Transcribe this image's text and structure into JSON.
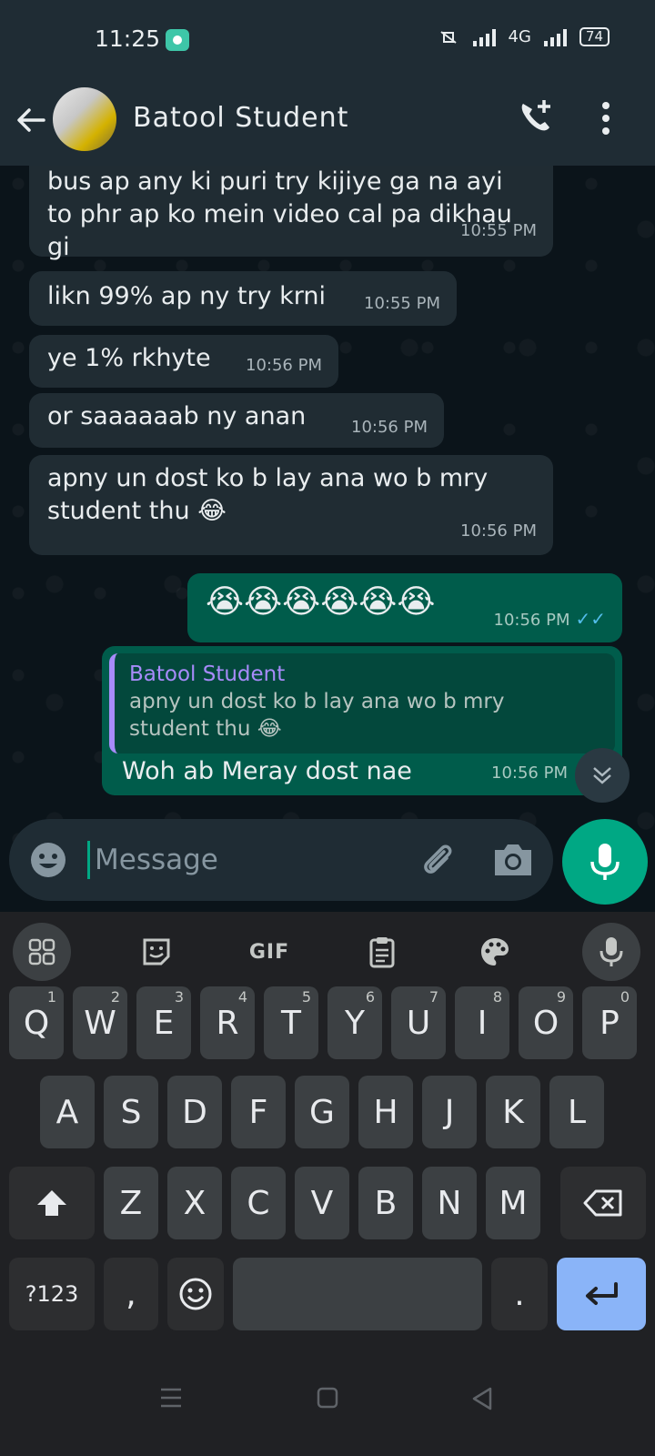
{
  "status_bar": {
    "time": "11:25",
    "network": "4G",
    "battery": "74"
  },
  "header": {
    "contact_name": "Batool Student",
    "icons": [
      "back-arrow-icon",
      "avatar",
      "add-call-icon",
      "more-vert-icon"
    ]
  },
  "messages": [
    {
      "direction": "in",
      "text_lines": [
        "bus ap any ki puri try kijiye ga na ayi",
        "to phr ap ko mein video cal pa dikhau",
        "gi"
      ],
      "time": "10:55 PM"
    },
    {
      "direction": "in",
      "text": "likn 99% ap ny try krni",
      "time": "10:55 PM"
    },
    {
      "direction": "in",
      "text": "ye 1% rkhyte",
      "time": "10:56 PM"
    },
    {
      "direction": "in",
      "text": "or saaaaaab ny anan",
      "time": "10:56 PM"
    },
    {
      "direction": "in",
      "text_lines": [
        "apny un dost ko b lay ana wo b mry",
        "student thu 😂"
      ],
      "time": "10:56 PM"
    },
    {
      "direction": "out",
      "text": "😭😭😭😭😭😭",
      "time": "10:56 PM",
      "status": "read"
    },
    {
      "direction": "out",
      "quote_name": "Batool Student",
      "quote_lines": [
        "apny un dost ko b lay ana wo b mry",
        "student thu 😂"
      ],
      "text": "Woh ab Meray dost nae",
      "time": "10:56 PM"
    }
  ],
  "input": {
    "placeholder": "Message"
  },
  "keyboard": {
    "toolbar": [
      "apps-icon",
      "sticker-icon",
      "GIF",
      "clipboard-icon",
      "palette-icon",
      "mic-icon"
    ],
    "row1": [
      "Q",
      "W",
      "E",
      "R",
      "T",
      "Y",
      "U",
      "I",
      "O",
      "P"
    ],
    "row1_hints": [
      "1",
      "2",
      "3",
      "4",
      "5",
      "6",
      "7",
      "8",
      "9",
      "0"
    ],
    "row2": [
      "A",
      "S",
      "D",
      "F",
      "G",
      "H",
      "J",
      "K",
      "L"
    ],
    "row3": [
      "Z",
      "X",
      "C",
      "V",
      "B",
      "N",
      "M"
    ],
    "symbols_label": "?123",
    "comma": ",",
    "period": "."
  },
  "colors": {
    "incoming_bubble": "#202c33",
    "outgoing_bubble": "#005c4b",
    "accent": "#00a884",
    "quote_accent": "#a78bfa",
    "read_ticks": "#53bdeb"
  }
}
